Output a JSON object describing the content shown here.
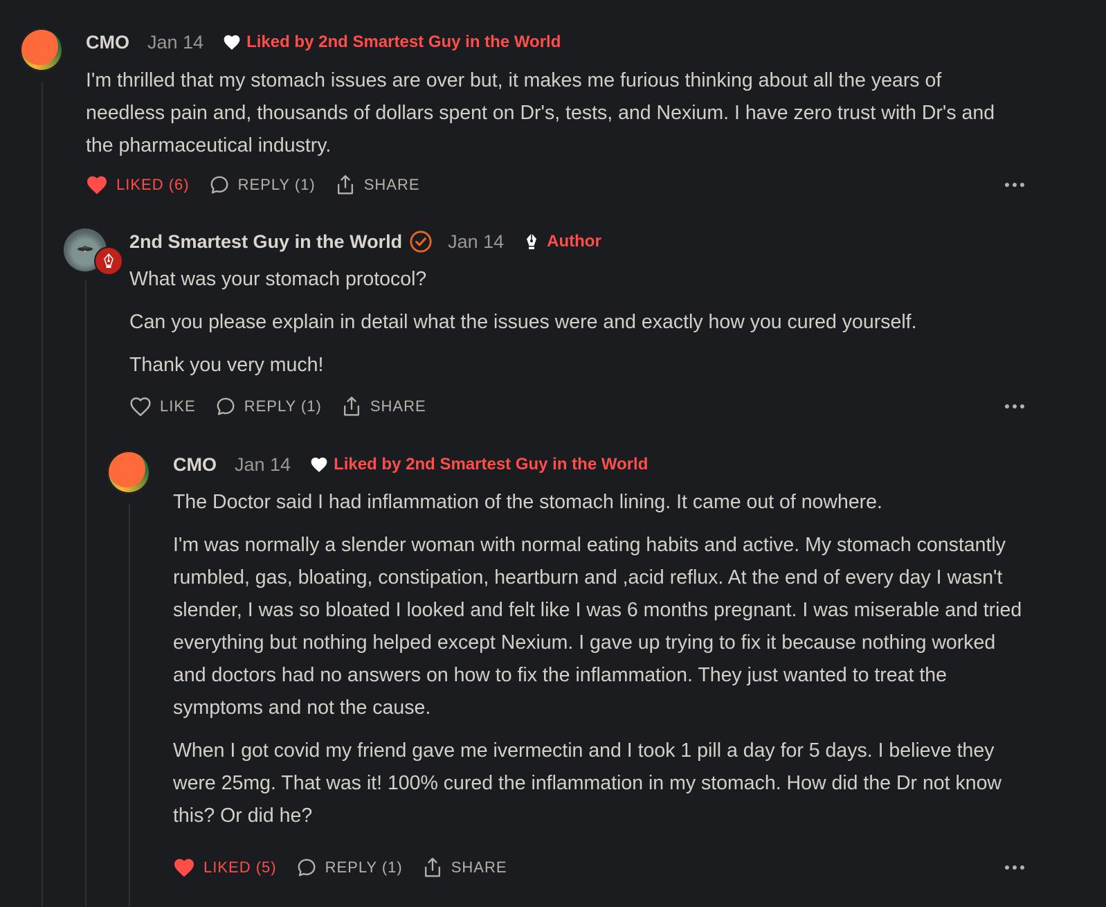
{
  "colors": {
    "background": "#1b1c1f",
    "accent_red": "#ff4e4a",
    "verified_orange": "#e8661f",
    "author_badge_red": "#c0211c"
  },
  "comments": [
    {
      "author": "CMO",
      "date": "Jan 14",
      "liked_by": "Liked by 2nd Smartest Guy in the World",
      "paragraphs": [
        "I'm thrilled that my stomach issues are over but, it makes me furious thinking about all the years of needless pain and, thousands of dollars spent on Dr's, tests, and Nexium. I have zero trust with Dr's and the pharmaceutical industry."
      ],
      "like_label": "LIKED (6)",
      "reply_label": "REPLY (1)",
      "share_label": "SHARE",
      "liked": true,
      "icons": [
        "heart-icon",
        "speech-bubble-icon",
        "share-icon",
        "more-icon"
      ]
    },
    {
      "author": "2nd Smartest Guy in the World",
      "date": "Jan 14",
      "author_tag": "Author",
      "paragraphs": [
        "What was your stomach protocol?",
        "Can you please explain in detail what the issues were and exactly how you cured yourself.",
        "Thank you very much!"
      ],
      "like_label": "LIKE",
      "reply_label": "REPLY (1)",
      "share_label": "SHARE",
      "liked": false,
      "icons": [
        "verified-check-icon",
        "fountain-pen-icon",
        "heart-outline-icon",
        "speech-bubble-icon",
        "share-icon",
        "more-icon"
      ]
    },
    {
      "author": "CMO",
      "date": "Jan 14",
      "liked_by": "Liked by 2nd Smartest Guy in the World",
      "paragraphs": [
        "The Doctor said I had inflammation of the stomach lining. It came out of nowhere.",
        "I'm was normally a slender woman with normal eating habits and active. My stomach constantly rumbled, gas, bloating, constipation, heartburn and ,acid reflux. At the end of every day I wasn't slender, I was so bloated I looked and felt like I was 6 months pregnant. I was miserable and tried everything but nothing helped except Nexium. I gave up trying to fix it because nothing worked and doctors had no answers on how to fix the inflammation. They just wanted to treat the symptoms and not the cause.",
        "When I got covid my friend gave me ivermectin and I took 1 pill a day for 5 days. I believe they were 25mg. That was it! 100% cured the inflammation in my stomach. How did the Dr not know this? Or did he?"
      ],
      "like_label": "LIKED (5)",
      "reply_label": "REPLY (1)",
      "share_label": "SHARE",
      "liked": true,
      "icons": [
        "heart-icon",
        "speech-bubble-icon",
        "share-icon",
        "more-icon"
      ]
    }
  ]
}
